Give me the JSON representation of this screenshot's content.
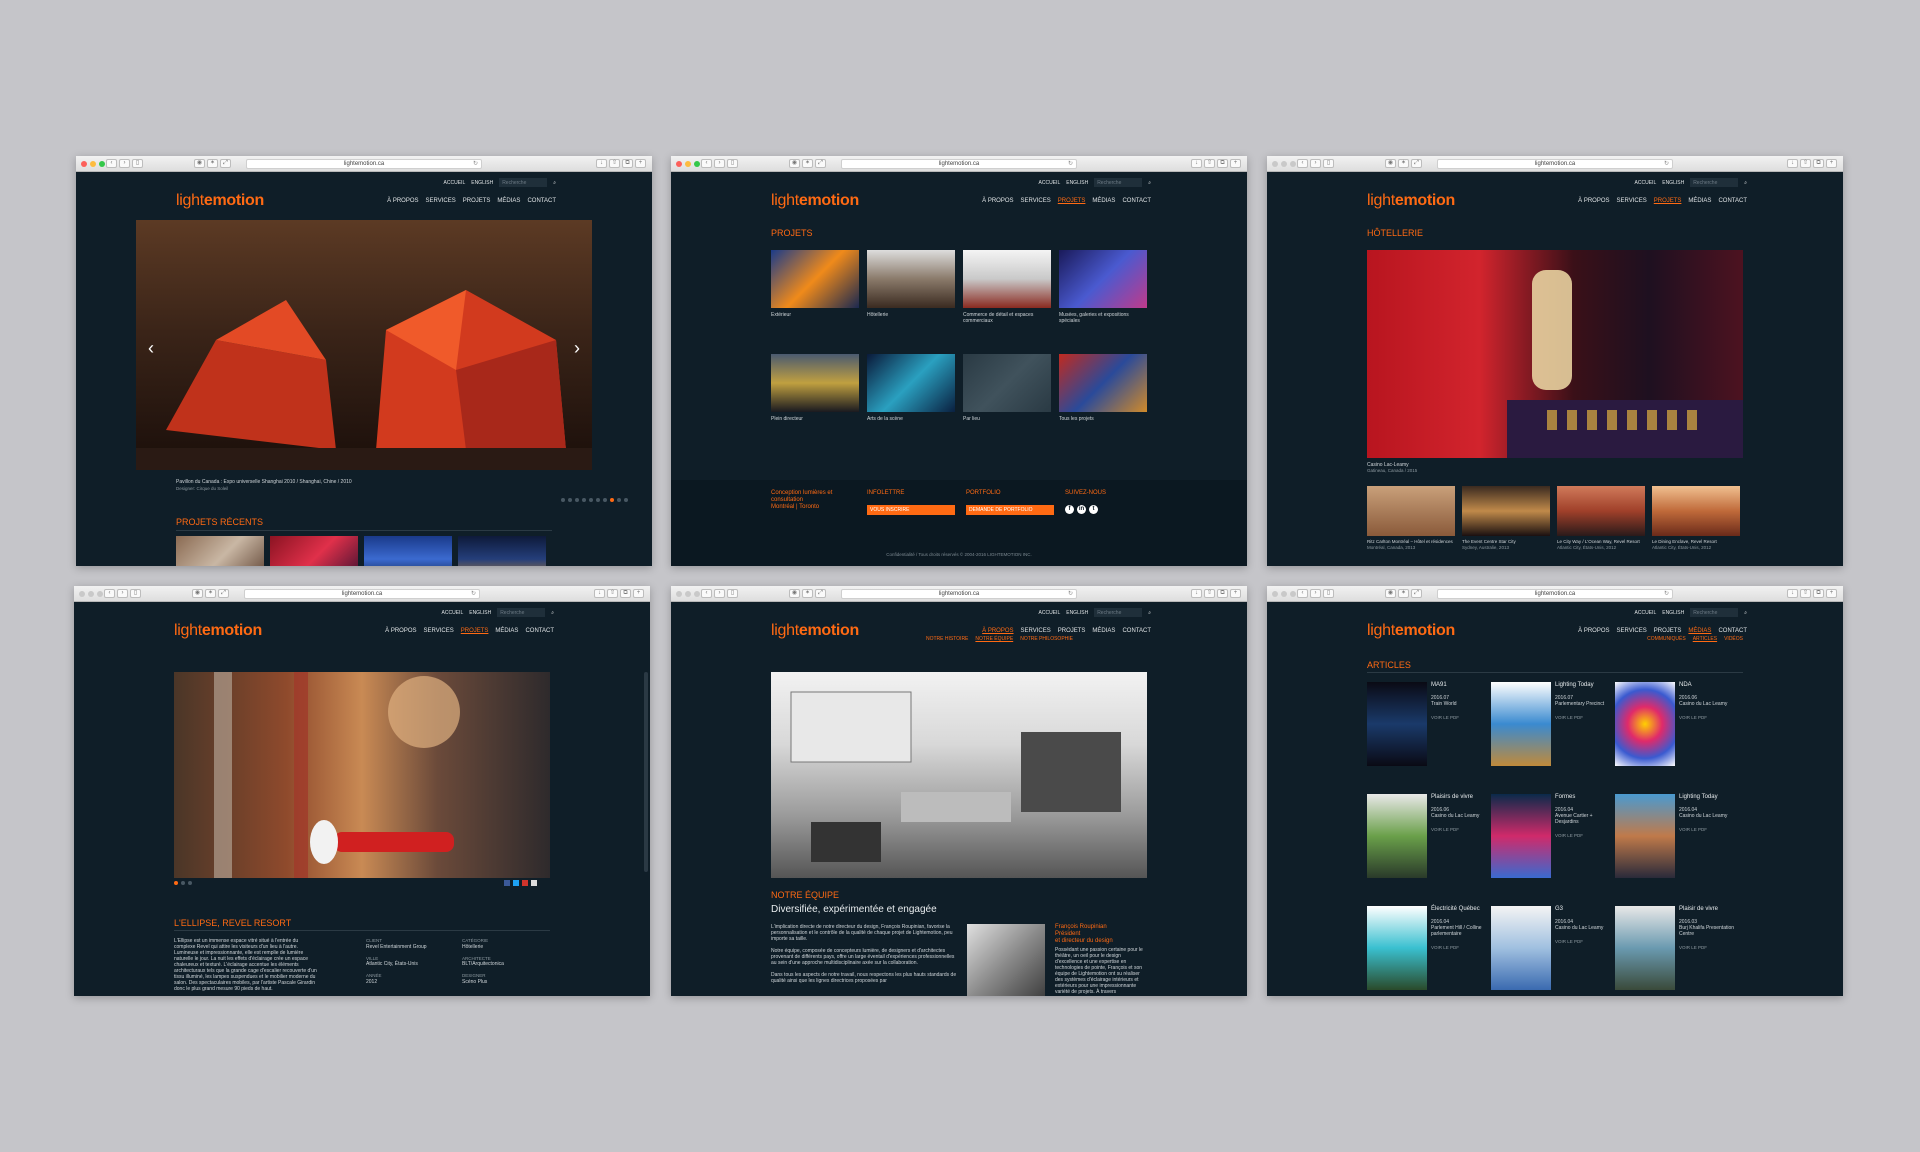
{
  "url": "lightemotion.ca",
  "logo": {
    "light": "light",
    "emotion": "emotion"
  },
  "topbar": {
    "accueil": "ACCUEIL",
    "english": "ENGLISH",
    "search_placeholder": "Recherche"
  },
  "nav": [
    "À PROPOS",
    "SERVICES",
    "PROJETS",
    "MÉDIAS",
    "CONTACT"
  ],
  "w1": {
    "caption": "Pavillon du Canada : Expo universelle Shanghai 2010 / Shanghai, Chine / 2010",
    "designer": "Designer: Cirque du Soleil",
    "recent_title": "PROJETS RÉCENTS"
  },
  "w2": {
    "title": "PROJETS",
    "cells": [
      "Extérieur",
      "Hôtellerie",
      "Commerce de détail et espaces commerciaux",
      "Musées, galeries et expositions spéciales",
      "Plein directeur",
      "Arts de la scène",
      "Par lieu",
      "Tous les projets"
    ],
    "footer": {
      "col1": "Conception lumières et consultation",
      "col1b": "Montréal | Toronto",
      "infolettre": "INFOLETTRE",
      "infolettre_btn": "VOUS INSCRIRE",
      "portfolio": "PORTFOLIO",
      "portfolio_btn": "DEMANDE DE PORTFOLIO",
      "suivez": "SUIVEZ-NOUS",
      "copyright": "Confidentialité / Tous droits réservés © 2004-2016 LIGHTEMOTION INC."
    }
  },
  "w3": {
    "title": "HÔTELLERIE",
    "caption": "Casino Lac-Leamy",
    "caption_sub": "Gatineau, Canada / 2015",
    "thumbs": [
      {
        "t": "Ritz Carlton Montréal – Hôtel et résidences",
        "s": "Montréal, Canada, 2013"
      },
      {
        "t": "The Event Centre Star City",
        "s": "Sydney, Australie, 2013"
      },
      {
        "t": "Le City Way / L'Ocean Way, Revel Resort",
        "s": "Atlantic City, États-Unis, 2012"
      },
      {
        "t": "Le Dining Enclave, Revel Resort",
        "s": "Atlantic City, États-Unis, 2012"
      }
    ]
  },
  "w4": {
    "title": "L'ELLIPSE, REVEL RESORT",
    "body": "L'Ellipse est un immense espace vitré situé à l'entrée du complexe Revel qui attire les visiteurs d'un lieu à l'autre. Lumineuse et impressionnante, elle est remplie de lumière naturelle le jour. La nuit les effets d'éclairage crée un espace chaleureux et texturé. L'éclairage accentue les éléments architecturaux tels que la grande cage d'escalier recouverte d'un tissu illuminé, les lampes suspendues et le mobilier moderne du salon. Des spectaculaires mobiles, par l'artiste Pascale Girardin donc le plus grand mesure 90 pieds de haut.",
    "client_l": "CLIENT",
    "client": "Revel Entertainment Group",
    "ville_l": "VILLE",
    "ville": "Atlantic City, États-Unis",
    "annee_l": "ANNÉE",
    "annee": "2012",
    "cat_l": "CATÉGORIE",
    "cat": "Hôtellerie",
    "arch_l": "ARCHITECTE",
    "arch": "BLT/Arquitectonica",
    "des_l": "DESIGNER",
    "des": "Scéno Plus"
  },
  "w5": {
    "subnav": [
      "NOTRE HISTOIRE",
      "NOTRE ÉQUIPE",
      "NOTRE PHILOSOPHIE"
    ],
    "title": "NOTRE ÉQUIPE",
    "subtitle": "Diversifiée, expérimentée et engagée",
    "p1": "L'implication directe de notre directeur du design, François Roupinian, favorise la personnalisation et le contrôle de la qualité de chaque projet de Lightemotion, peu importe sa taille.",
    "p2": "Notre équipe, composée de concepteurs lumière, de designers et d'architectes provenant de différents pays, offre un large éventail d'expériences professionnelles au sein d'une approche multidisciplinaire axée sur la collaboration.",
    "p3": "Dans tous les aspects de notre travail, nous respectons les plus hauts standards de qualité ainsi que les lignes directrices proposées par",
    "person": "François Roupinian",
    "role1": "Président",
    "role2": "et directeur du design",
    "bio": "Possédant une passion certaine pour le théâtre, un oeil pour le design d'excellence et une expertise en technologies de pointe, François et son équipe de Lightemotion ont su réaliser des systèmes d'éclairage intérieurs et extérieurs pour une impressionnante variété de projets. À travers"
  },
  "w6": {
    "subnav": [
      "COMMUNIQUÉS",
      "ARTICLES",
      "VIDÉOS"
    ],
    "title": "ARTICLES",
    "pdf": "VOIR LE PDF",
    "articles": [
      {
        "t": "MA91",
        "d": "2016.07",
        "s": "Train World"
      },
      {
        "t": "Lighting Today",
        "d": "2016.07",
        "s": "Parlementary Precinct"
      },
      {
        "t": "NDA",
        "d": "2016.06",
        "s": "Casino du Lac Leamy"
      },
      {
        "t": "Plaisirs de vivre",
        "d": "2016.06",
        "s": "Casino du Lac Leamy"
      },
      {
        "t": "Formes",
        "d": "2016.04",
        "s": "Avenue Cartier + Desjardins"
      },
      {
        "t": "Lighting Today",
        "d": "2016.04",
        "s": "Casino du Lac Leamy"
      },
      {
        "t": "Électricité Québec",
        "d": "2016.04",
        "s": "Parlement Hill / Colline parlementaire"
      },
      {
        "t": "G3",
        "d": "2016.04",
        "s": "Casino du Lac Leamy"
      },
      {
        "t": "Plaisir de vivre",
        "d": "2016.03",
        "s": "Burj Khalifa Presentation Centre"
      }
    ]
  }
}
